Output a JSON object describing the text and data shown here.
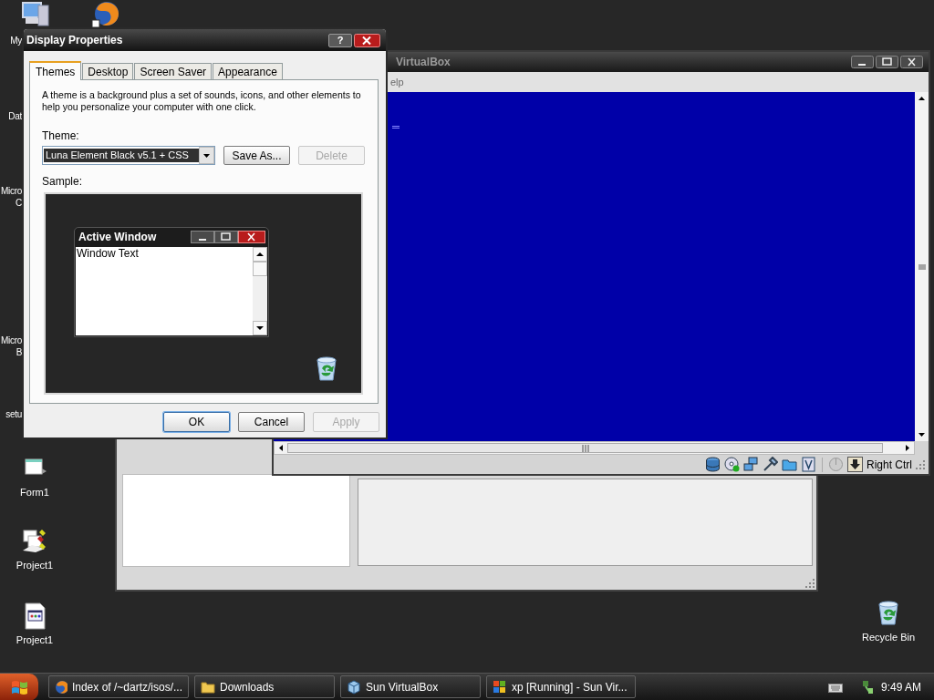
{
  "desktop": {
    "cut_icon_labels": [
      {
        "lines": [
          "My"
        ]
      },
      {
        "lines": [
          "Dat"
        ]
      },
      {
        "lines": [
          "Micro",
          "C"
        ]
      },
      {
        "lines": [
          "Micro",
          "B"
        ]
      },
      {
        "lines": [
          "setu"
        ]
      }
    ],
    "icons": [
      {
        "label": "Form1",
        "kind": "form"
      },
      {
        "label": "Project1",
        "kind": "project"
      },
      {
        "label": "Project1",
        "kind": "file"
      },
      {
        "label": "Recycle Bin",
        "kind": "recycle-bin"
      }
    ]
  },
  "virtualbox_window": {
    "title": "VirtualBox",
    "menu": "elp",
    "host_key": "Right Ctrl"
  },
  "dialog": {
    "title": "Display Properties",
    "help_button": "?",
    "tabs": [
      {
        "label": "Themes",
        "selected": true
      },
      {
        "label": "Desktop",
        "selected": false
      },
      {
        "label": "Screen Saver",
        "selected": false
      },
      {
        "label": "Appearance",
        "selected": false
      }
    ],
    "description": "A theme is a background plus a set of sounds, icons, and other elements to help you personalize your computer with one click.",
    "theme_label": "Theme:",
    "theme_value": "Luna Element Black v5.1 + CSS",
    "theme_buttons": [
      {
        "label": "Save As...",
        "disabled": false
      },
      {
        "label": "Delete",
        "disabled": true
      }
    ],
    "sample_label": "Sample:",
    "sample_window_title": "Active Window",
    "sample_window_text": "Window Text",
    "buttons": [
      {
        "label": "OK",
        "disabled": false,
        "default": true
      },
      {
        "label": "Cancel",
        "disabled": false,
        "default": false
      },
      {
        "label": "Apply",
        "disabled": true,
        "default": false
      }
    ]
  },
  "taskbar": {
    "tasks": [
      {
        "label": "Index of /~dartz/isos/...",
        "kind": "browser"
      },
      {
        "label": "Downloads",
        "kind": "folder"
      },
      {
        "label": "Sun VirtualBox",
        "kind": "cube"
      },
      {
        "label": "xp [Running] - Sun Vir...",
        "kind": "vm"
      }
    ],
    "clock": "9:49 AM"
  }
}
